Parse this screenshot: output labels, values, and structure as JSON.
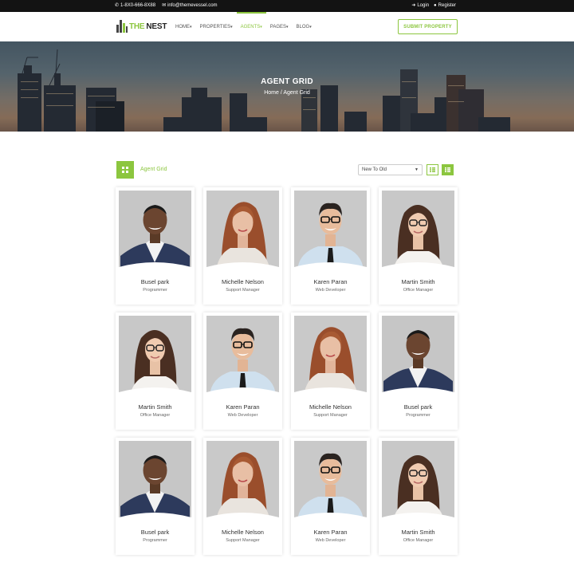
{
  "topbar": {
    "phone": "1-8X0-666-8X88",
    "email": "info@themevessel.com",
    "login": "Login",
    "register": "Register"
  },
  "header": {
    "logo_part1": "THE",
    "logo_part2": "NEST",
    "nav": [
      {
        "label": "HOME",
        "active": false
      },
      {
        "label": "PROPERTIES",
        "active": false
      },
      {
        "label": "AGENTS",
        "active": true
      },
      {
        "label": "PAGES",
        "active": false
      },
      {
        "label": "BLOG",
        "active": false
      }
    ],
    "submit_label": "SUBMIT PROPERTY"
  },
  "hero": {
    "title": "AGENT GRID",
    "breadcrumb_home": "Home",
    "breadcrumb_sep": "/",
    "breadcrumb_current": "Agent Grid"
  },
  "toolbar": {
    "grid_label": "Agent Grid",
    "sort_value": "New To Old"
  },
  "colors": {
    "accent": "#8cc63f",
    "topbar": "#131313"
  },
  "agents": [
    {
      "name": "Busel park",
      "role": "Programmer",
      "avatar": "man-dark"
    },
    {
      "name": "Michelle Nelson",
      "role": "Support Manager",
      "avatar": "woman-red"
    },
    {
      "name": "Karen Paran",
      "role": "Web Developer",
      "avatar": "man-glasses"
    },
    {
      "name": "Martin Smith",
      "role": "Office Manager",
      "avatar": "woman-glasses"
    },
    {
      "name": "Martin Smith",
      "role": "Office Manager",
      "avatar": "woman-glasses"
    },
    {
      "name": "Karen Paran",
      "role": "Web Developer",
      "avatar": "man-glasses"
    },
    {
      "name": "Michelle Nelson",
      "role": "Support Manager",
      "avatar": "woman-red"
    },
    {
      "name": "Busel park",
      "role": "Programmer",
      "avatar": "man-dark"
    },
    {
      "name": "Busel park",
      "role": "Programmer",
      "avatar": "man-dark"
    },
    {
      "name": "Michelle Nelson",
      "role": "Support Manager",
      "avatar": "woman-red"
    },
    {
      "name": "Karen Paran",
      "role": "Web Developer",
      "avatar": "man-glasses"
    },
    {
      "name": "Martin Smith",
      "role": "Office Manager",
      "avatar": "woman-glasses"
    }
  ]
}
